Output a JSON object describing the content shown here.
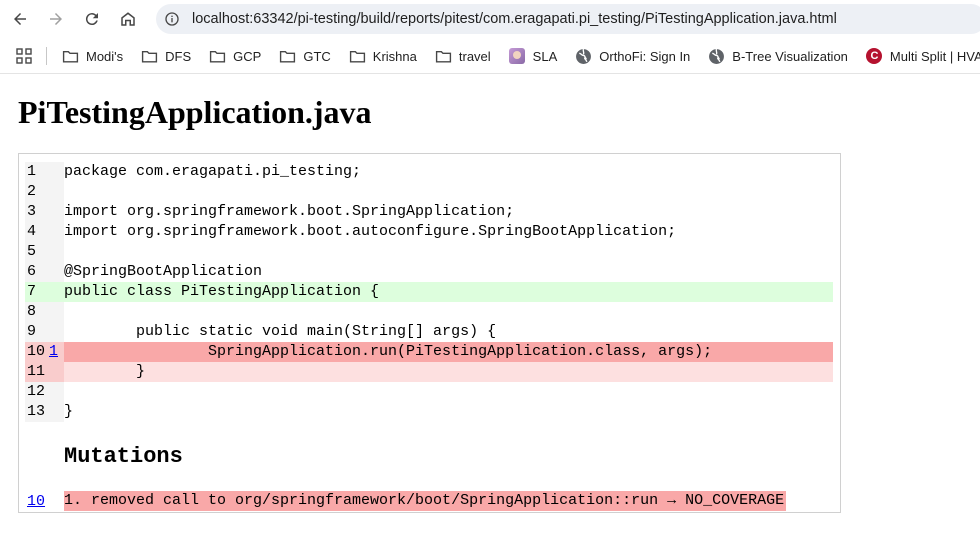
{
  "browser": {
    "url": "localhost:63342/pi-testing/build/reports/pitest/com.eragapati.pi_testing/PiTestingApplication.java.html",
    "bookmarks": [
      {
        "label": "Modi's",
        "icon": "folder-icon"
      },
      {
        "label": "DFS",
        "icon": "folder-icon"
      },
      {
        "label": "GCP",
        "icon": "folder-icon"
      },
      {
        "label": "GTC",
        "icon": "folder-icon"
      },
      {
        "label": "Krishna",
        "icon": "folder-icon"
      },
      {
        "label": "travel",
        "icon": "folder-icon"
      },
      {
        "label": "SLA",
        "icon": "avatar-icon"
      },
      {
        "label": "OrthoFi: Sign In",
        "icon": "globe-icon"
      },
      {
        "label": "B-Tree Visualization",
        "icon": "globe-icon"
      },
      {
        "label": "Multi Split | HVAC |...",
        "icon": "brand-icon"
      }
    ],
    "brand_icon_letter": "C"
  },
  "page": {
    "title": "PiTestingApplication.java",
    "lines": [
      {
        "num": "1",
        "mutation": "",
        "text": "package com.eragapati.pi_testing;",
        "status": "none"
      },
      {
        "num": "2",
        "mutation": "",
        "text": "",
        "status": "none"
      },
      {
        "num": "3",
        "mutation": "",
        "text": "import org.springframework.boot.SpringApplication;",
        "status": "none"
      },
      {
        "num": "4",
        "mutation": "",
        "text": "import org.springframework.boot.autoconfigure.SpringBootApplication;",
        "status": "none"
      },
      {
        "num": "5",
        "mutation": "",
        "text": "",
        "status": "none"
      },
      {
        "num": "6",
        "mutation": "",
        "text": "@SpringBootApplication",
        "status": "none"
      },
      {
        "num": "7",
        "mutation": "",
        "text": "public class PiTestingApplication {",
        "status": "covered"
      },
      {
        "num": "8",
        "mutation": "",
        "text": "",
        "status": "none"
      },
      {
        "num": "9",
        "mutation": "",
        "text": "        public static void main(String[] args) {",
        "status": "none"
      },
      {
        "num": "10",
        "mutation": "1",
        "text": "                SpringApplication.run(PiTestingApplication.class, args);",
        "status": "uncovered-strong"
      },
      {
        "num": "11",
        "mutation": "",
        "text": "        }",
        "status": "uncovered"
      },
      {
        "num": "12",
        "mutation": "",
        "text": "",
        "status": "none"
      },
      {
        "num": "13",
        "mutation": "",
        "text": "}",
        "status": "none"
      }
    ],
    "mutations_heading": "Mutations",
    "mutations": [
      {
        "line": "10",
        "text": "1. removed call to org/springframework/boot/SpringApplication::run → NO_COVERAGE"
      }
    ]
  },
  "colors": {
    "covered": "#ddfedd",
    "uncovered": "#fde0e0",
    "uncovered_strong": "#f9a8a8",
    "link": "#0000ee"
  }
}
